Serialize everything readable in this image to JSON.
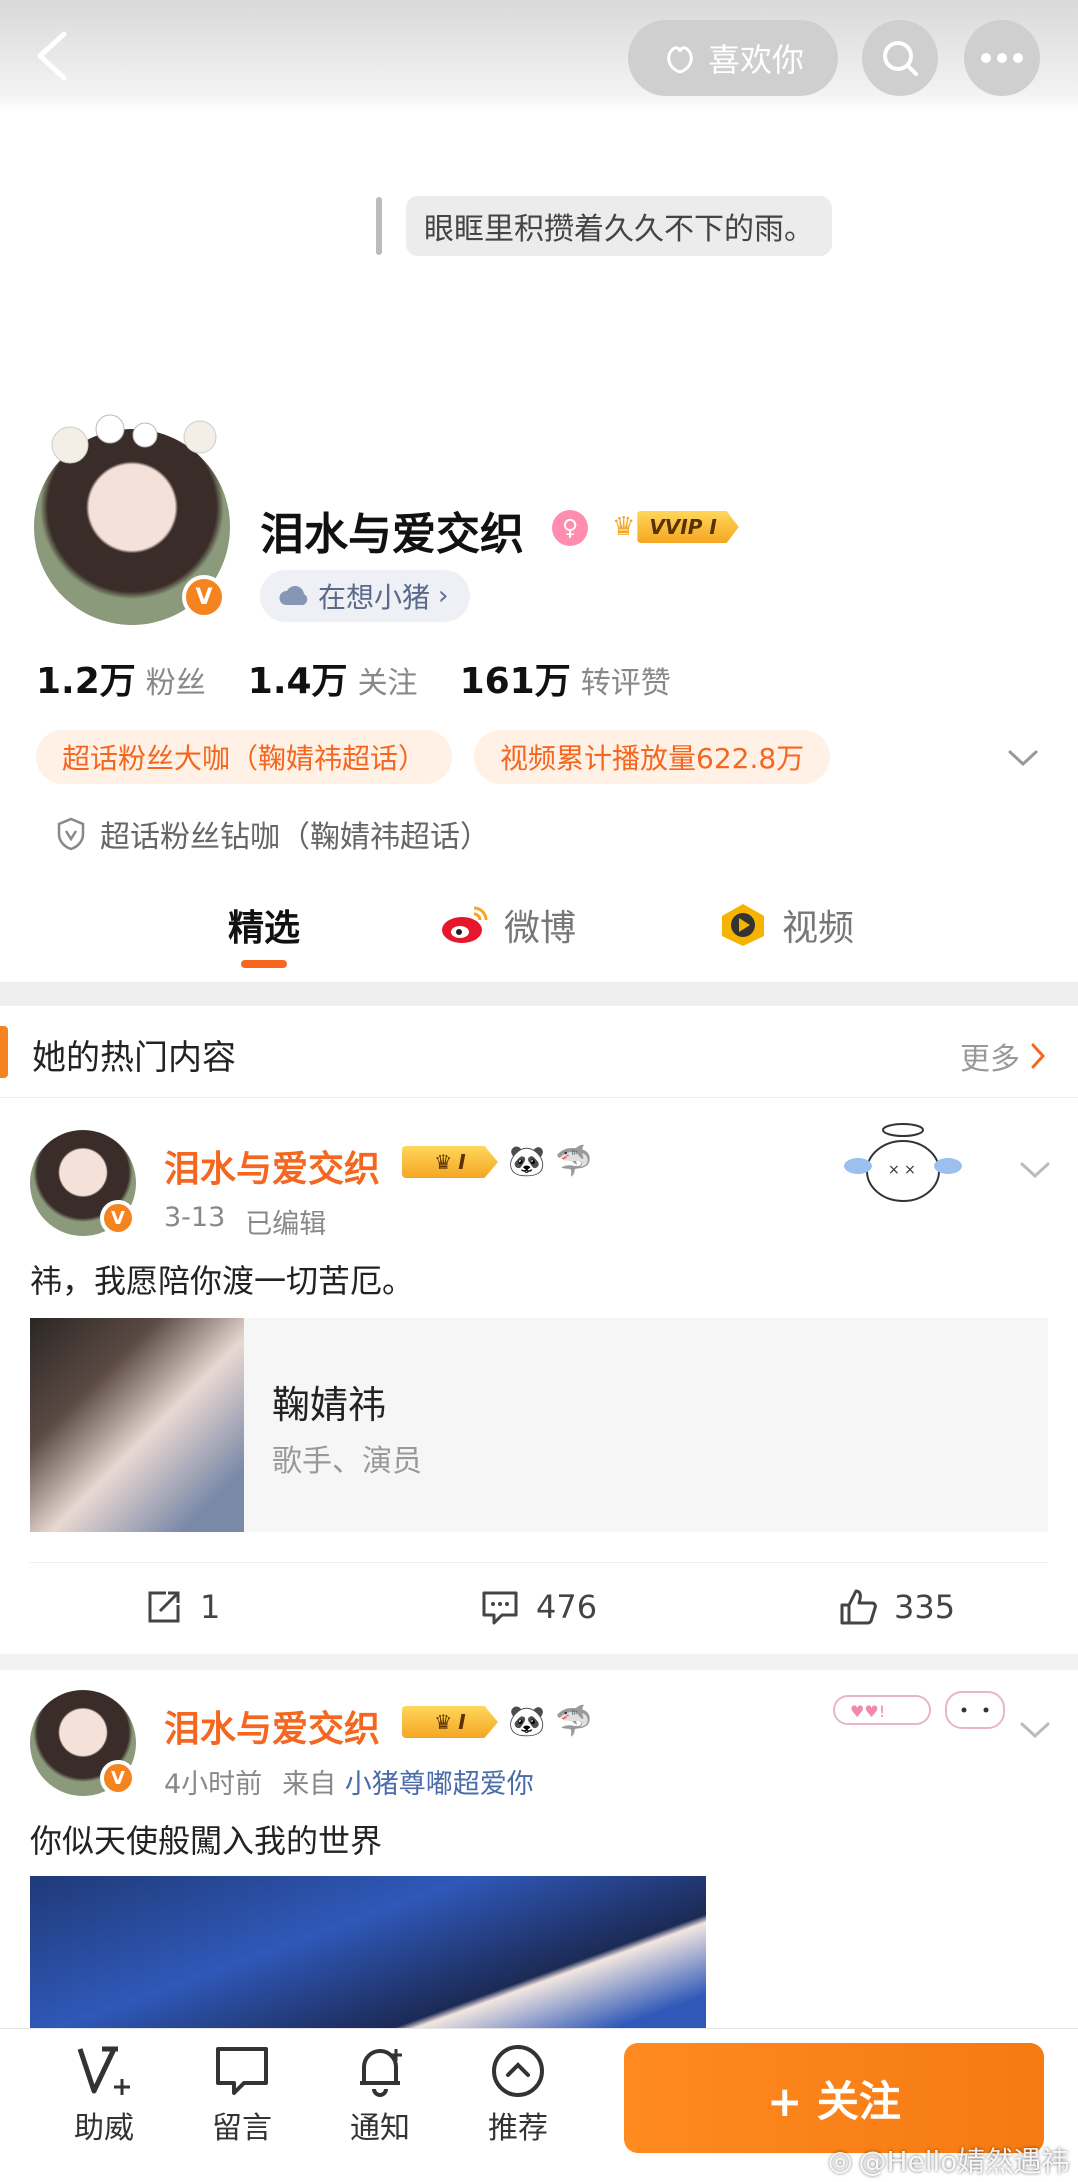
{
  "header": {
    "back_icon": "chevron-left-icon",
    "like_label": "喜欢你",
    "search_icon": "search-icon",
    "more_icon": "more-dots-icon"
  },
  "profile": {
    "motto": "眼眶里积攒着久久不下的雨。",
    "name": "泪水与爱交织",
    "vip_label": "VVIP I",
    "thinking": "在想小猪",
    "stats": [
      {
        "num": "1.2万",
        "label": "粉丝"
      },
      {
        "num": "1.4万",
        "label": "关注"
      },
      {
        "num": "161万",
        "label": "转评赞"
      }
    ],
    "tags": [
      "超话粉丝大咖（鞠婧祎超话）",
      "视频累计播放量622.8万"
    ],
    "superfan": "超话粉丝钻咖（鞠婧祎超话）"
  },
  "tabs": [
    {
      "label": "精选"
    },
    {
      "label": "微博"
    },
    {
      "label": "视频"
    }
  ],
  "section": {
    "title": "她的热门内容",
    "more": "更多"
  },
  "posts": [
    {
      "name": "泪水与爱交织",
      "vip": "I",
      "date": "3-13",
      "edited": "已编辑",
      "text": "祎，我愿陪你渡一切苦厄。",
      "card": {
        "title": "鞠婧祎",
        "subtitle": "歌手、演员"
      },
      "reposts": "1",
      "comments": "476",
      "likes": "335"
    },
    {
      "name": "泪水与爱交织",
      "vip": "I",
      "time": "4小时前",
      "from_label": "来自",
      "source": "小猪尊嘟超爱你",
      "text": "你似天使般闖入我的世界"
    }
  ],
  "bottom_bar": {
    "items": [
      "助威",
      "留言",
      "通知",
      "推荐"
    ],
    "follow": "+ 关注"
  },
  "watermark": "@Hello婧然遇祎",
  "colors": {
    "accent": "#f5661f",
    "follow": "#ff8a1f",
    "link": "#4a6ca8"
  }
}
